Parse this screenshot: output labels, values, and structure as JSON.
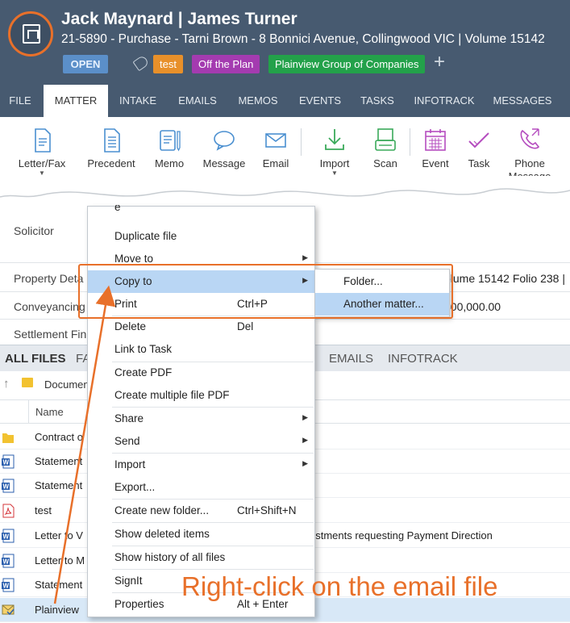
{
  "header": {
    "title": "Jack Maynard | James Turner",
    "subtitle": "21-5890 - Purchase - Tarni Brown - 8 Bonnici Avenue, Collingwood VIC | Volume 15142",
    "status": "OPEN",
    "tags": [
      "test",
      "Off the Plan",
      "Plainview Group of Companies"
    ],
    "add_symbol": "+"
  },
  "tabs": [
    "FILE",
    "MATTER",
    "INTAKE",
    "EMAILS",
    "MEMOS",
    "EVENTS",
    "TASKS",
    "INFOTRACK",
    "MESSAGES"
  ],
  "active_tab": "MATTER",
  "ribbon": {
    "letter_fax": "Letter/Fax",
    "precedent": "Precedent",
    "memo": "Memo",
    "message": "Message",
    "email": "Email",
    "import": "Import",
    "scan": "Scan",
    "event": "Event",
    "task": "Task",
    "phone_line1": "Phone",
    "phone_line2": "Message"
  },
  "background_fields": {
    "solicitor": "Solicitor",
    "property": "Property Deta",
    "property_value": "olume 15142 Folio 238 |",
    "conveyancing": "Conveyancing",
    "conveyancing_value": "300,000.00",
    "settlement": "Settlement Fin"
  },
  "file_tabs": {
    "all_files": "ALL FILES",
    "partial": "FA",
    "emails": "EMAILS",
    "infotrack": "INFOTRACK"
  },
  "breadcrumb": {
    "up": "↑",
    "folder": "Documen"
  },
  "column_name": "Name",
  "files": [
    {
      "name": "Contract o",
      "type": "folder"
    },
    {
      "name": "Statement",
      "type": "word"
    },
    {
      "name": "Statement",
      "type": "word"
    },
    {
      "name": "test",
      "type": "pdf"
    },
    {
      "name": "Letter to V",
      "type": "word"
    },
    {
      "name": "Letter to M",
      "type": "word"
    },
    {
      "name": "Statement",
      "type": "word"
    },
    {
      "name": "Plainview",
      "type": "email"
    }
  ],
  "file_detail_partial": "ustments requesting Payment Direction",
  "context_menu": {
    "partial_top": "e",
    "items": [
      {
        "label": "Duplicate file",
        "shortcut": "",
        "submenu": false
      },
      {
        "label": "Move to",
        "shortcut": "",
        "submenu": true
      },
      {
        "label": "Copy to",
        "shortcut": "",
        "submenu": true
      },
      {
        "label": "Print",
        "shortcut": "Ctrl+P",
        "submenu": false
      },
      {
        "label": "Delete",
        "shortcut": "Del",
        "submenu": false
      },
      {
        "label": "Link to Task",
        "shortcut": "",
        "submenu": false
      },
      {
        "label": "Create PDF",
        "shortcut": "",
        "submenu": false
      },
      {
        "label": "Create multiple file PDF",
        "shortcut": "",
        "submenu": false
      },
      {
        "label": "Share",
        "shortcut": "",
        "submenu": true
      },
      {
        "label": "Send",
        "shortcut": "",
        "submenu": true
      },
      {
        "label": "Import",
        "shortcut": "",
        "submenu": true
      },
      {
        "label": "Export...",
        "shortcut": "",
        "submenu": false
      },
      {
        "label": "Create new folder...",
        "shortcut": "Ctrl+Shift+N",
        "submenu": false
      },
      {
        "label": "Show deleted items",
        "shortcut": "",
        "submenu": false
      },
      {
        "label": "Show history of all files",
        "shortcut": "",
        "submenu": false
      },
      {
        "label": "SignIt",
        "shortcut": "",
        "submenu": false
      },
      {
        "label": "Properties",
        "shortcut": "Alt + Enter",
        "submenu": false
      }
    ],
    "highlighted": "Copy to"
  },
  "submenu": {
    "items": [
      "Folder...",
      "Another matter..."
    ],
    "highlighted": "Another matter..."
  },
  "annotation": "Right-click on the email file",
  "colors": {
    "header_bg": "#475a70",
    "accent": "#e8702a",
    "highlight": "#b9d6f4"
  }
}
